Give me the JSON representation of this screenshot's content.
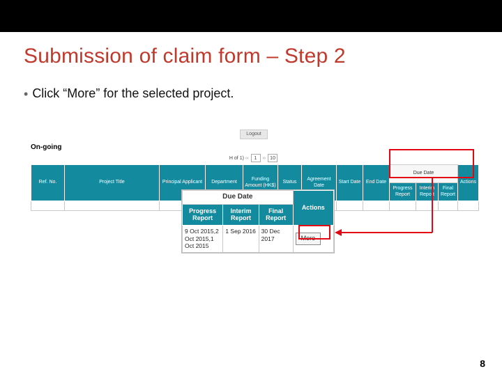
{
  "title": "Submission of claim form – Step 2",
  "bullet": "Click “More” for the selected project.",
  "logout": "Logout",
  "ongoing": "On-going",
  "pager": {
    "prefix": "H of 1)",
    "page": "1",
    "perpage": "10"
  },
  "main_headers": {
    "ref": "Ref. No.",
    "title": "Project Title",
    "pi": "Principal Applicant",
    "dept": "Department",
    "fund": "Funding Amount (HK$)",
    "status": "Status",
    "agdate": "Agreement Date",
    "start": "Start Date",
    "end": "End Date",
    "due_group": "Due Date",
    "prog": "Progress Report",
    "interim": "Interim Report",
    "final": "Final Report",
    "actions": "Actions"
  },
  "zoom": {
    "due_group": "Due Date",
    "prog": "Progress Report",
    "interim": "Interim Report",
    "final": "Final Report",
    "actions": "Actions",
    "row": {
      "prog": "9 Oct 2015,2 Oct 2015,1 Oct 2015",
      "interim": "1 Sep 2016",
      "final": "30 Dec 2017",
      "more": "More"
    }
  },
  "pagenum": "8"
}
